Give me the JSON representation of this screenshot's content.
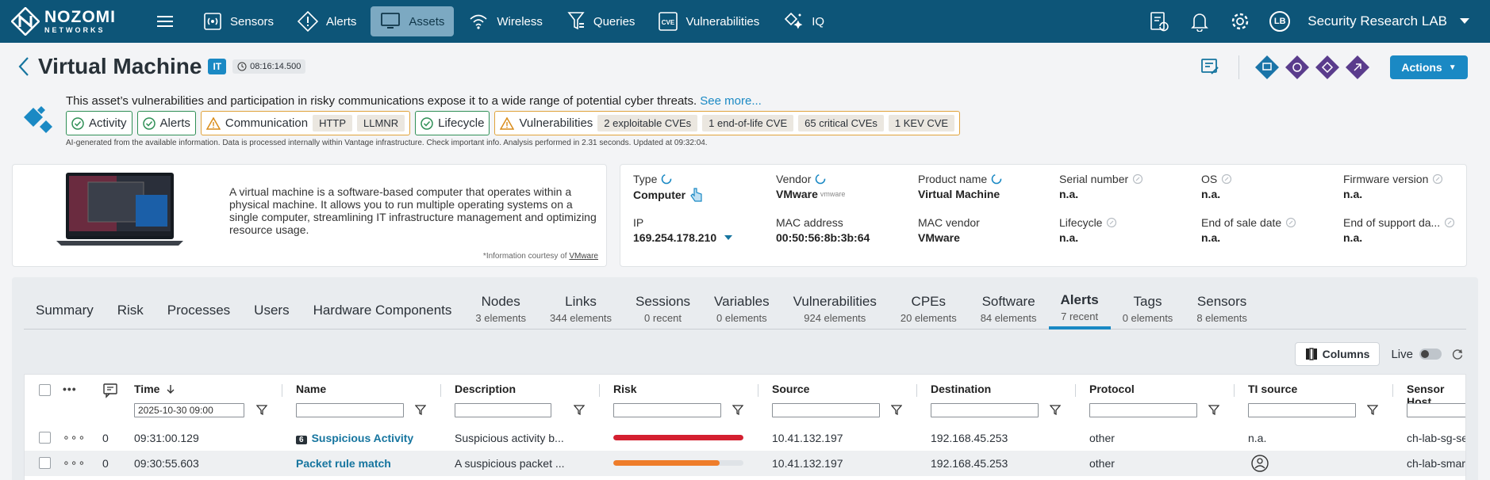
{
  "nav": {
    "brand_line1": "NOZOMI",
    "brand_line2": "NETWORKS",
    "items": [
      {
        "label": "Sensors",
        "icon": "sensors-icon"
      },
      {
        "label": "Alerts",
        "icon": "alert-icon"
      },
      {
        "label": "Assets",
        "icon": "monitor-icon",
        "active": true
      },
      {
        "label": "Wireless",
        "icon": "wireless-icon"
      },
      {
        "label": "Queries",
        "icon": "queries-icon"
      },
      {
        "label": "Vulnerabilities",
        "icon": "cve-icon"
      },
      {
        "label": "IQ",
        "icon": "sparkle-icon"
      }
    ],
    "cve_text": "CVE",
    "avatar": "LB",
    "tenant": "Security Research LAB"
  },
  "asset": {
    "title": "Virtual Machine",
    "type_badge": "IT",
    "time": "08:16:14.500",
    "actions_label": "Actions"
  },
  "ai": {
    "summary": "This asset’s vulnerabilities and participation in risky communications expose it to a wide range of potential cyber threats.",
    "see_more": "See more...",
    "chips": {
      "activity": "Activity",
      "alerts": "Alerts",
      "communication": "Communication",
      "comm_tags": [
        "HTTP",
        "LLMNR"
      ],
      "lifecycle": "Lifecycle",
      "vulnerabilities": "Vulnerabilities",
      "vuln_tags": [
        "2 exploitable CVEs",
        "1 end-of-life CVE",
        "65 critical CVEs",
        "1 KEV CVE"
      ]
    },
    "disclaimer": "AI-generated from the available information. Data is processed internally within Vantage infrastructure. Check important info. Analysis performed in 2.31 seconds.  Updated at 09:32:04."
  },
  "info_card": {
    "description": "A virtual machine is a software-based computer that operates within a physical machine. It allows you to run multiple operating systems on a single computer, streamlining IT infrastructure management and optimizing resource usage.",
    "credit_prefix": "*Information courtesy of",
    "credit_link": "VMware"
  },
  "attributes": {
    "type": {
      "label": "Type",
      "value": "Computer"
    },
    "vendor": {
      "label": "Vendor",
      "value": "VMware",
      "logo_text": "vmware"
    },
    "product_name": {
      "label": "Product name",
      "value": "Virtual Machine"
    },
    "serial": {
      "label": "Serial number",
      "value": "n.a."
    },
    "os": {
      "label": "OS",
      "value": "n.a."
    },
    "firmware": {
      "label": "Firmware version",
      "value": "n.a."
    },
    "ip": {
      "label": "IP",
      "value": "169.254.178.210"
    },
    "mac": {
      "label": "MAC address",
      "value": "00:50:56:8b:3b:64"
    },
    "mac_vendor": {
      "label": "MAC vendor",
      "value": "VMware"
    },
    "lifecycle": {
      "label": "Lifecycle",
      "value": "n.a."
    },
    "end_of_sale": {
      "label": "End of sale date",
      "value": "n.a."
    },
    "end_of_support": {
      "label": "End of support da...",
      "value": "n.a."
    }
  },
  "tabs": [
    {
      "label": "Summary"
    },
    {
      "label": "Risk"
    },
    {
      "label": "Processes"
    },
    {
      "label": "Users"
    },
    {
      "label": "Hardware Components"
    },
    {
      "label": "Nodes",
      "sub": "3 elements"
    },
    {
      "label": "Links",
      "sub": "344 elements"
    },
    {
      "label": "Sessions",
      "sub": "0 recent"
    },
    {
      "label": "Variables",
      "sub": "0 elements"
    },
    {
      "label": "Vulnerabilities",
      "sub": "924 elements"
    },
    {
      "label": "CPEs",
      "sub": "20 elements"
    },
    {
      "label": "Software",
      "sub": "84 elements"
    },
    {
      "label": "Alerts",
      "sub": "7 recent",
      "active": true
    },
    {
      "label": "Tags",
      "sub": "0 elements"
    },
    {
      "label": "Sensors",
      "sub": "8 elements"
    }
  ],
  "toolbar": {
    "columns_label": "Columns",
    "live_label": "Live"
  },
  "table": {
    "headers": {
      "time": "Time",
      "name": "Name",
      "description": "Description",
      "risk": "Risk",
      "source": "Source",
      "destination": "Destination",
      "protocol": "Protocol",
      "ti_source": "TI source",
      "sensor_host": "Sensor Host"
    },
    "time_filter": "2025-10-30 09:00",
    "rows": [
      {
        "comments": "0",
        "time": "09:31:00.129",
        "name_count": "6",
        "name": "Suspicious Activity",
        "description": "Suspicious activity b...",
        "risk_percent": 100,
        "risk_color": "#d41f30",
        "source": "10.41.132.197",
        "destination": "192.168.45.253",
        "protocol": "other",
        "ti_source": "n.a.",
        "sensor_host": "ch-lab-sg-sec"
      },
      {
        "comments": "0",
        "time": "09:30:55.603",
        "name": "Packet rule match",
        "description": "A suspicious packet ...",
        "risk_percent": 82,
        "risk_color": "#ee7d2b",
        "source": "10.41.132.197",
        "destination": "192.168.45.253",
        "protocol": "other",
        "ti_source_icon": "threat-intel-icon",
        "sensor_host": "ch-lab-smart"
      }
    ]
  }
}
